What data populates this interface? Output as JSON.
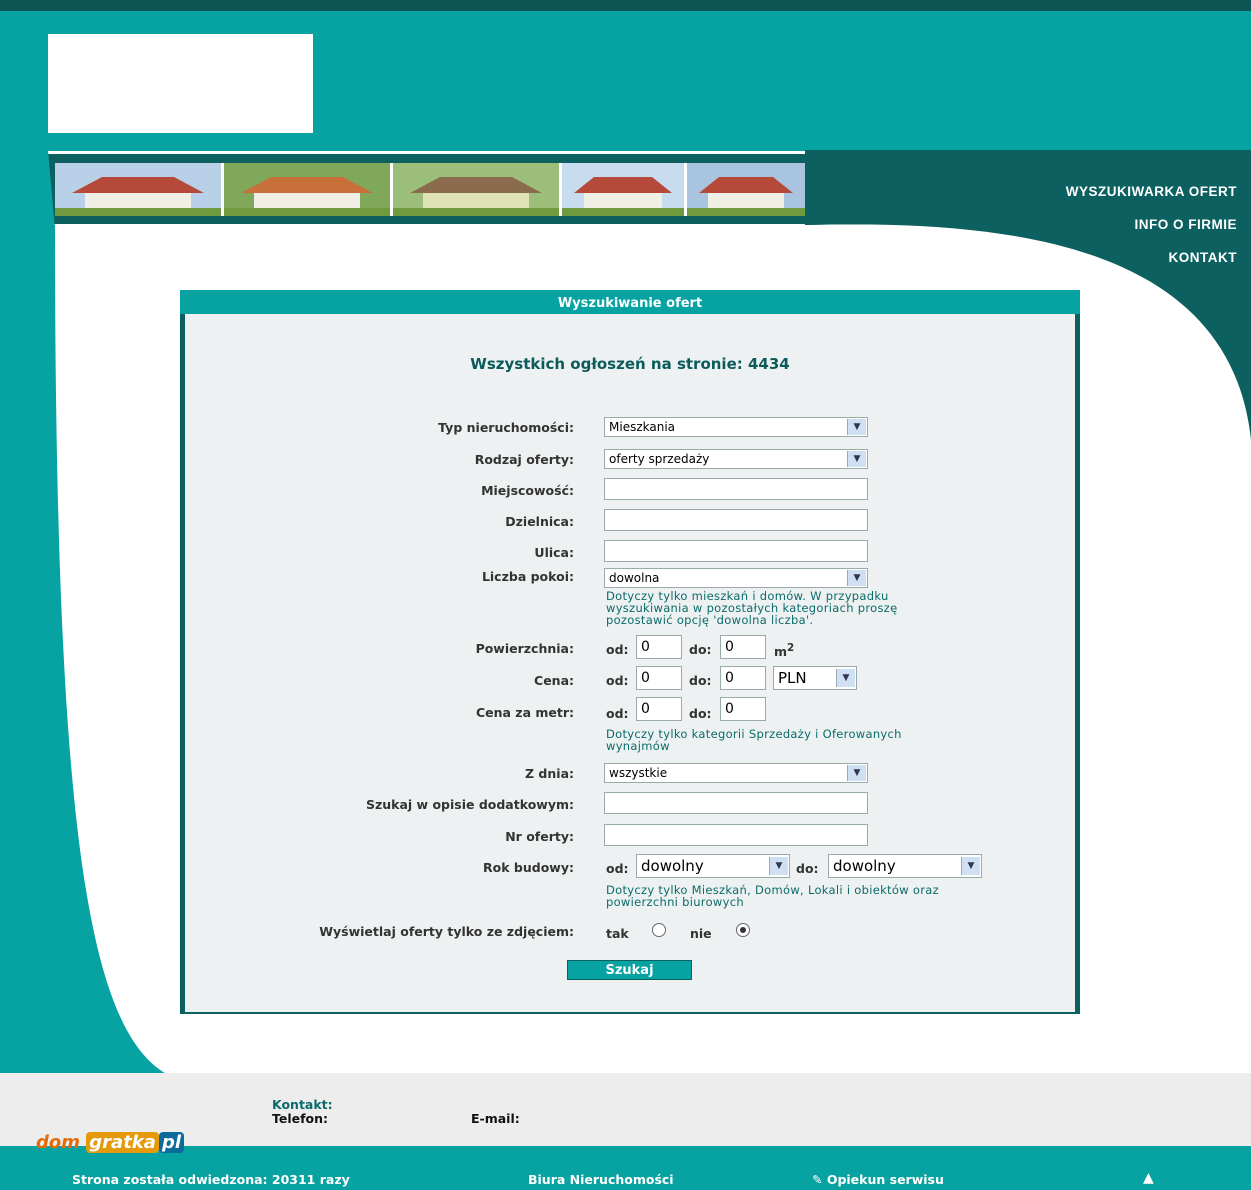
{
  "nav": {
    "items": [
      "WYSZUKIWARKA OFERT",
      "INFO O FIRMIE",
      "KONTAKT"
    ]
  },
  "panel": {
    "title": "Wyszukiwanie ofert",
    "total_text": "Wszystkich ogłoszeń na stronie: 4434"
  },
  "form": {
    "typ_label": "Typ nieruchomości:",
    "typ_value": "Mieszkania",
    "rodzaj_label": "Rodzaj oferty:",
    "rodzaj_value": "oferty sprzedaży",
    "miejscowosc_label": "Miejscowość:",
    "dzielnica_label": "Dzielnica:",
    "ulica_label": "Ulica:",
    "pokoje_label": "Liczba pokoi:",
    "pokoje_value": "dowolna",
    "pokoje_hint_1": "Dotyczy tylko mieszkań i domów. W przypadku",
    "pokoje_hint_2": "wyszukiwania w pozostałych kategoriach proszę",
    "pokoje_hint_3": "pozostawić opcję 'dowolna liczba'.",
    "pow_label": "Powierzchnia:",
    "od": "od:",
    "do": "do:",
    "pow_od": "0",
    "pow_do": "0",
    "pow_unit": "m",
    "pow_unit_sup": "2",
    "cena_label": "Cena:",
    "cena_od": "0",
    "cena_do": "0",
    "currency": "PLN",
    "cenam_label": "Cena za metr:",
    "cenam_od": "0",
    "cenam_do": "0",
    "cenam_hint_1": "Dotyczy tylko kategorii Sprzedaży i Oferowanych",
    "cenam_hint_2": "wynajmów",
    "zdnia_label": "Z dnia:",
    "zdnia_value": "wszystkie",
    "opis_label": "Szukaj w opisie dodatkowym:",
    "nr_label": "Nr oferty:",
    "rok_label": "Rok budowy:",
    "rok_od": "dowolny",
    "rok_do": "dowolny",
    "rok_hint_1": "Dotyczy tylko Mieszkań, Domów, Lokali i obiektów oraz",
    "rok_hint_2": "powierzchni biurowych",
    "zdjecie_label": "Wyświetlaj oferty tylko ze zdjęciem:",
    "tak": "tak",
    "nie": "nie",
    "selected_option": "nie",
    "submit": "Szukaj"
  },
  "footer": {
    "kontakt": "Kontakt:",
    "telefon": "Telefon:",
    "email": "E-mail:",
    "brand_dom": "dom",
    "brand_gratka": "gratka",
    "brand_pl": "pl",
    "visits": "Strona została odwiedzona: 20311 razy",
    "biura": "Biura Nieruchomości",
    "opiekun": "Opiekun serwisu"
  },
  "colors": {
    "teal": "#07a2a2",
    "dark_teal": "#0d6060"
  }
}
